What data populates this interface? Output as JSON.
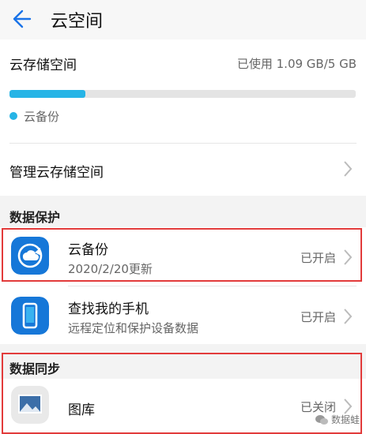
{
  "header": {
    "title": "云空间"
  },
  "storage": {
    "label": "云存储空间",
    "used": "已使用 1.09 GB/5 GB",
    "progress_fraction": 0.22,
    "legend": "云备份",
    "legend_color": "#26b4e6"
  },
  "manage_label": "管理云存储空间",
  "sections": {
    "protection": "数据保护",
    "sync": "数据同步"
  },
  "items": [
    {
      "name": "云备份",
      "sub": "2020/2/20更新",
      "status": "已开启"
    },
    {
      "name": "查找我的手机",
      "sub": "远程定位和保护设备数据",
      "status": "已开启"
    },
    {
      "name": "图库",
      "status": "已关闭"
    }
  ],
  "watermark": "数据蛙"
}
